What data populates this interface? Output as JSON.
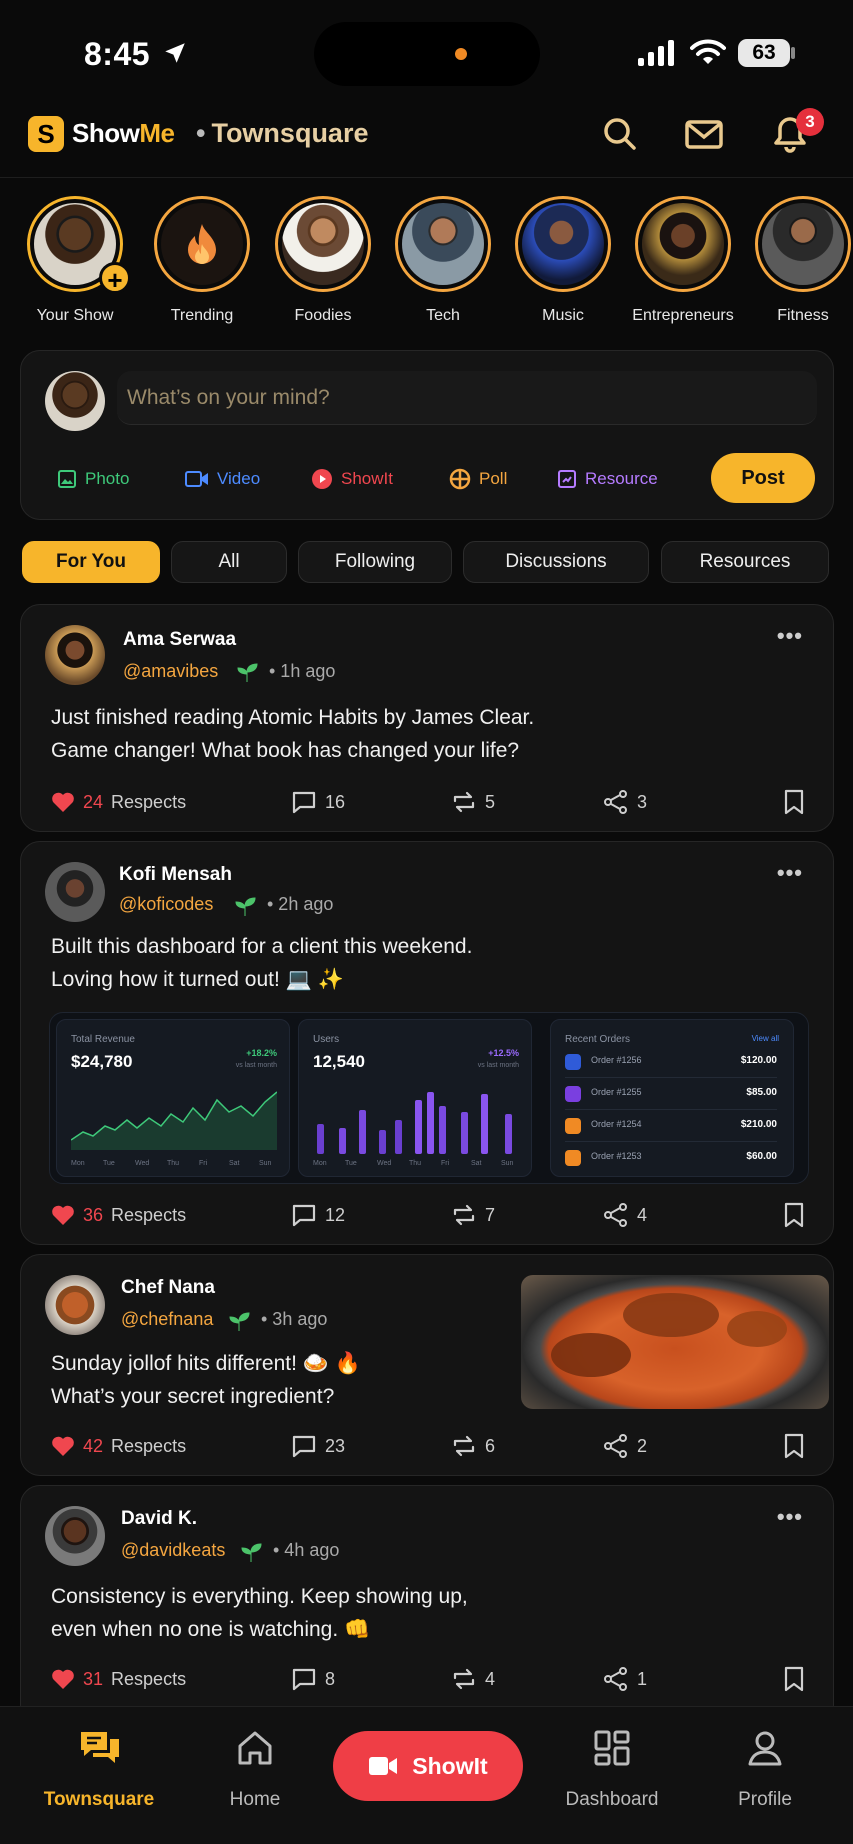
{
  "status_bar": {
    "time": "8:45",
    "battery": "63"
  },
  "header": {
    "brand_show": "Show",
    "brand_me": "Me",
    "title": "Townsquare",
    "notification_count": "3"
  },
  "stories": [
    {
      "label": "Your Show"
    },
    {
      "label": "Trending"
    },
    {
      "label": "Foodies"
    },
    {
      "label": "Tech"
    },
    {
      "label": "Music"
    },
    {
      "label": "Entrepreneurs"
    },
    {
      "label": "Fitness"
    }
  ],
  "composer": {
    "placeholder": "What’s on your mind?",
    "actions": {
      "photo": "Photo",
      "video": "Video",
      "showit": "ShowIt",
      "poll": "Poll",
      "resource": "Resource"
    },
    "post_label": "Post"
  },
  "tabs": [
    "For You",
    "All",
    "Following",
    "Discussions",
    "Resources"
  ],
  "posts": [
    {
      "name": "Ama Serwaa",
      "handle": "@amavibes",
      "time": "• 1h ago",
      "line1": "Just finished reading Atomic Habits by James Clear.",
      "line2": "Game changer! What book has changed your life?",
      "respects": "24",
      "respects_label": "Respects",
      "comments": "16",
      "reposts": "5",
      "shares": "3"
    },
    {
      "name": "Kofi Mensah",
      "handle": "@koficodes",
      "time": "• 2h ago",
      "line1": "Built this dashboard for a client this weekend.",
      "line2": "Loving how it turned out! 💻 ✨",
      "respects": "36",
      "respects_label": "Respects",
      "comments": "12",
      "reposts": "7",
      "shares": "4",
      "dashboard": {
        "revenue": {
          "label": "Total Revenue",
          "value": "$24,780",
          "change": "+18.2%",
          "sub": "vs last month"
        },
        "users": {
          "label": "Users",
          "value": "12,540",
          "change": "+12.5%",
          "sub": "vs last month"
        },
        "orders": {
          "label": "Recent Orders",
          "view_all": "View all",
          "items": [
            {
              "name": "Order #1256",
              "value": "$120.00"
            },
            {
              "name": "Order #1255",
              "value": "$85.00"
            },
            {
              "name": "Order #1254",
              "value": "$210.00"
            },
            {
              "name": "Order #1253",
              "value": "$60.00"
            }
          ]
        },
        "days": [
          "Mon",
          "Tue",
          "Wed",
          "Thu",
          "Fri",
          "Sat",
          "Sun"
        ]
      }
    },
    {
      "name": "Chef Nana",
      "handle": "@chefnana",
      "time": "• 3h ago",
      "line1": "Sunday jollof hits different! 🍛 🔥",
      "line2": "What’s your secret ingredient?",
      "respects": "42",
      "respects_label": "Respects",
      "comments": "23",
      "reposts": "6",
      "shares": "2"
    },
    {
      "name": "David K.",
      "handle": "@davidkeats",
      "time": "• 4h ago",
      "line1": "Consistency is everything. Keep showing up,",
      "line2": "even when no one is watching. 👊",
      "respects": "31",
      "respects_label": "Respects",
      "comments": "8",
      "reposts": "4",
      "shares": "1"
    }
  ],
  "bottom_nav": {
    "townsquare": "Townsquare",
    "home": "Home",
    "showit": "ShowIt",
    "dashboard": "Dashboard",
    "profile": "Profile"
  },
  "colors": {
    "accent": "#f7b52b",
    "red": "#ef3e46",
    "background": "#0a0a0a"
  }
}
